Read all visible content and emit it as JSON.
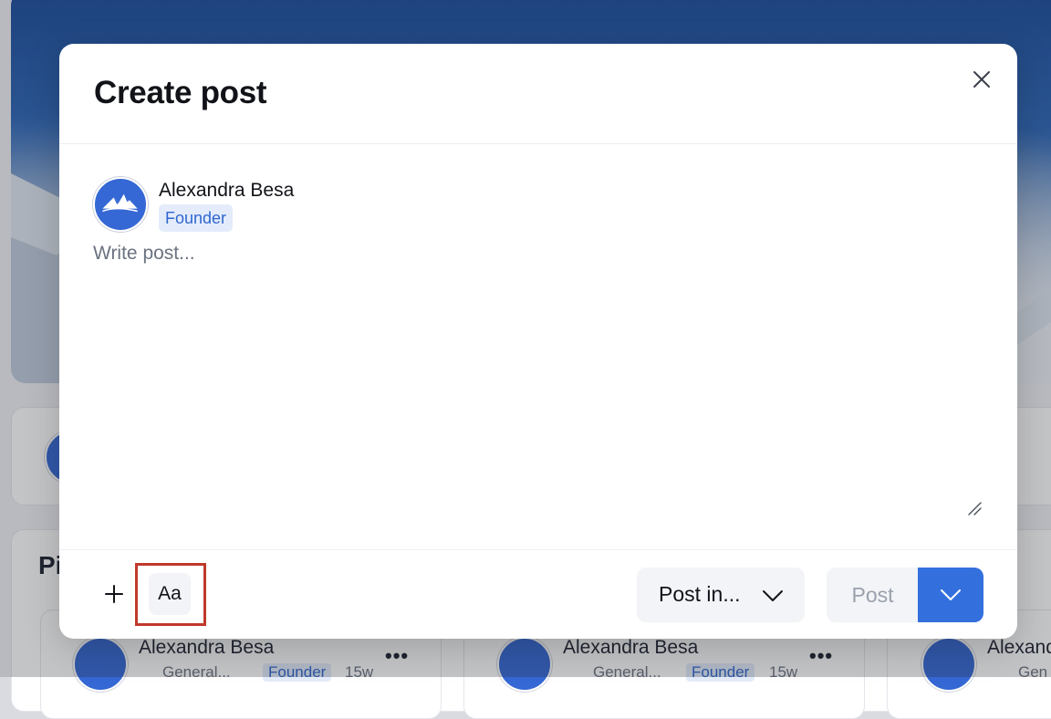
{
  "modal": {
    "title": "Create post",
    "close_icon": "close-icon"
  },
  "author": {
    "name": "Alexandra Besa",
    "role": "Founder",
    "avatar_icon": "mountain-logo-icon"
  },
  "composer": {
    "placeholder": "Write post..."
  },
  "footer": {
    "add_icon": "plus-icon",
    "format_label": "Aa",
    "post_in_label": "Post in...",
    "post_label": "Post",
    "post_menu_icon": "chevron-down-icon"
  },
  "background": {
    "pinned_heading": "Pi",
    "posts": [
      {
        "author": "Alexandra Besa",
        "channel": "General...",
        "role": "Founder",
        "age": "15w"
      },
      {
        "author": "Alexandra Besa",
        "channel": "General...",
        "role": "Founder",
        "age": "15w"
      },
      {
        "author": "Alexand",
        "channel": "Gen",
        "role": "",
        "age": ""
      }
    ]
  },
  "colors": {
    "accent": "#3370de",
    "badge_text": "#2f66d0",
    "badge_bg": "#e4ecfb",
    "highlight": "#c0392b"
  }
}
